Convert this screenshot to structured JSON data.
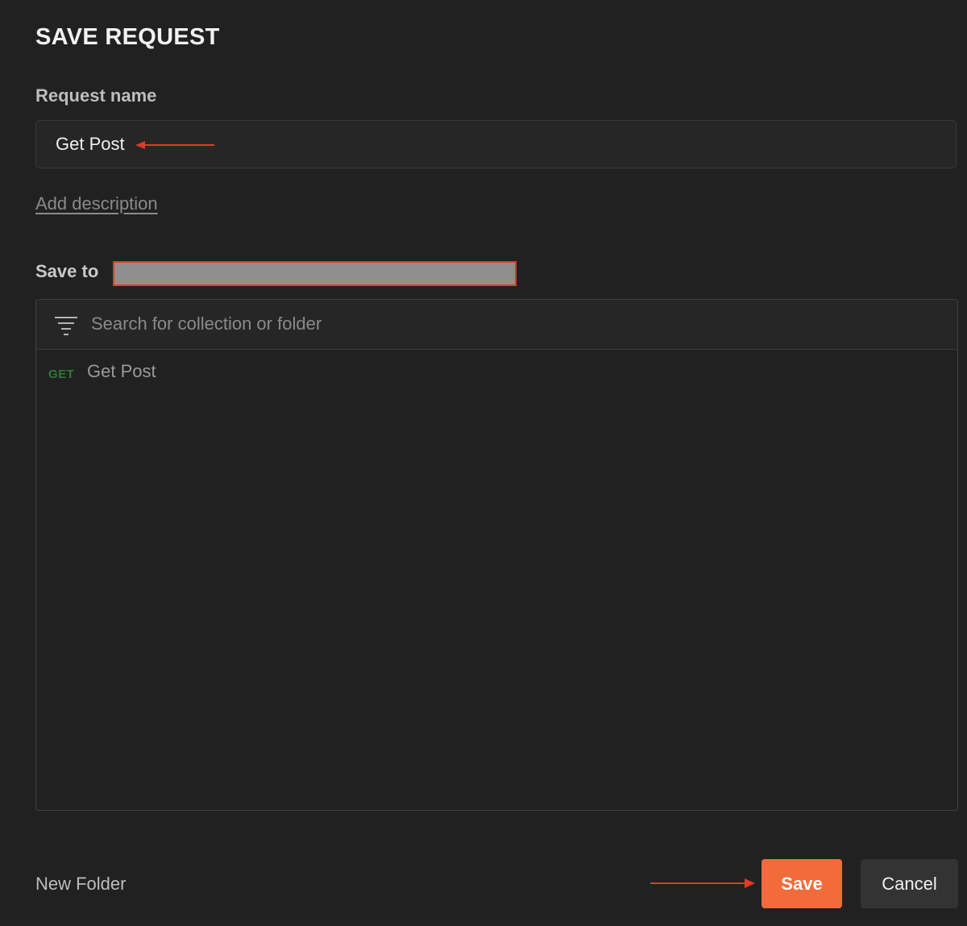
{
  "dialog": {
    "title": "SAVE REQUEST"
  },
  "request_name": {
    "label": "Request name",
    "value": "Get Post"
  },
  "add_description_link": "Add description",
  "save_to": {
    "label": "Save to"
  },
  "search": {
    "placeholder": "Search for collection or folder",
    "icon": "filter-icon"
  },
  "tree": {
    "items": [
      {
        "method": "GET",
        "label": "Get Post",
        "method_color": "#2f7a35"
      }
    ]
  },
  "footer": {
    "new_folder_label": "New Folder",
    "save_label": "Save",
    "cancel_label": "Cancel"
  },
  "colors": {
    "background": "#212121",
    "accent": "#f26b3a",
    "annotation": "#e03a2a",
    "redaction": "#8f8f8f"
  }
}
